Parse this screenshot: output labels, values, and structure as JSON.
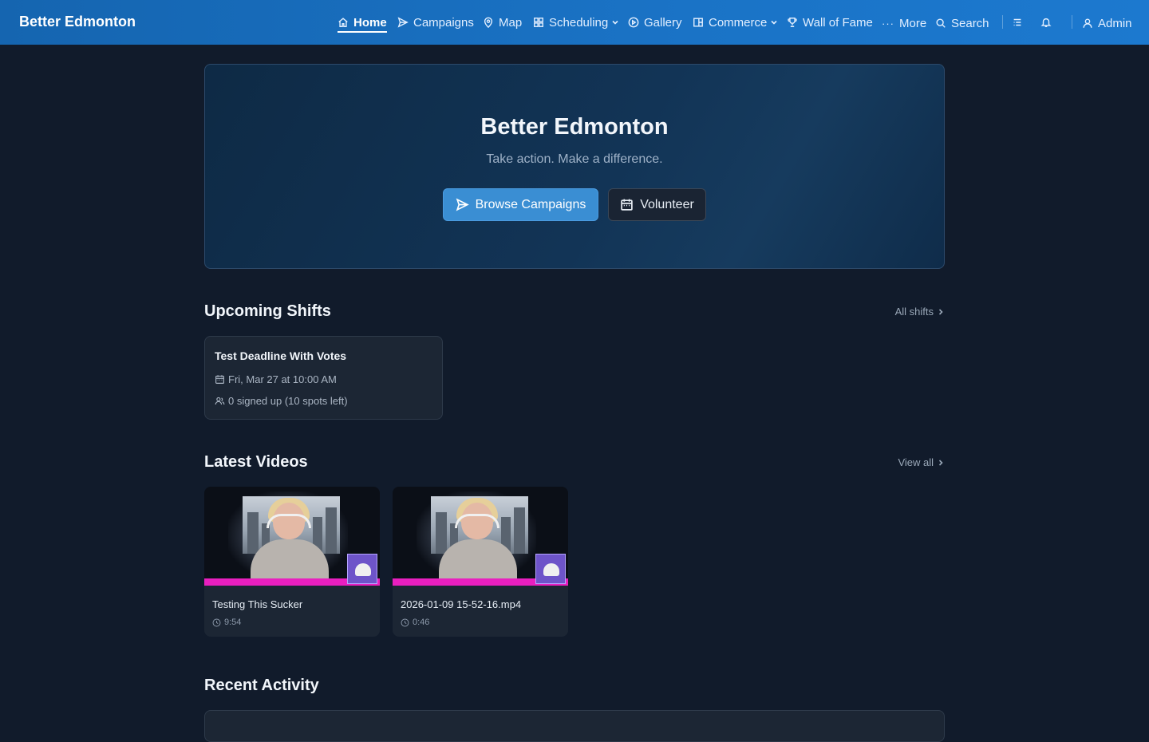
{
  "header": {
    "brand": "Better Edmonton",
    "nav": {
      "home": "Home",
      "campaigns": "Campaigns",
      "map": "Map",
      "scheduling": "Scheduling",
      "gallery": "Gallery",
      "commerce": "Commerce",
      "wall_of_fame": "Wall of Fame",
      "more": "More",
      "search": "Search",
      "admin": "Admin"
    }
  },
  "hero": {
    "title": "Better Edmonton",
    "subtitle": "Take action. Make a difference.",
    "primary_button": "Browse Campaigns",
    "secondary_button": "Volunteer"
  },
  "upcoming_shifts": {
    "title": "Upcoming Shifts",
    "link": "All shifts",
    "items": [
      {
        "title": "Test Deadline With Votes",
        "datetime": "Fri, Mar 27 at 10:00 AM",
        "signups": "0 signed up (10 spots left)"
      }
    ]
  },
  "latest_videos": {
    "title": "Latest Videos",
    "link": "View all",
    "items": [
      {
        "title": "Testing This Sucker",
        "duration": "9:54"
      },
      {
        "title": "2026-01-09 15-52-16.mp4",
        "duration": "0:46"
      }
    ]
  },
  "recent_activity": {
    "title": "Recent Activity"
  },
  "colors": {
    "topbar": "#1a73c6",
    "background": "#111b2b",
    "primary_button": "#3a8ed3",
    "card": "#1c2634"
  }
}
